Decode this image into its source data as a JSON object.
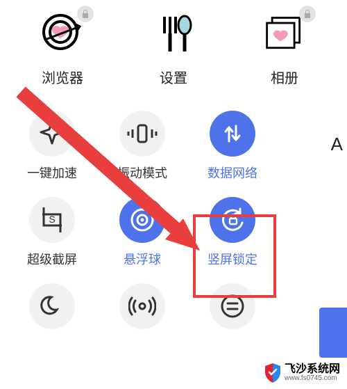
{
  "apps": [
    {
      "id": "browser",
      "label": "浏览器",
      "locked": true,
      "icon": "target-heart-icon"
    },
    {
      "id": "settings",
      "label": "设置",
      "locked": false,
      "icon": "cutlery-icon"
    },
    {
      "id": "gallery",
      "label": "相册",
      "locked": true,
      "icon": "photo-stack-icon"
    }
  ],
  "qs": {
    "row1": [
      {
        "id": "boost",
        "label": "一键加速",
        "on": false,
        "icon": "sparkle-icon"
      },
      {
        "id": "vibrate",
        "label": "振动模式",
        "on": false,
        "icon": "vibrate-icon"
      },
      {
        "id": "data",
        "label": "数据网络",
        "on": true,
        "icon": "data-arrows-icon"
      }
    ],
    "row2": [
      {
        "id": "sshot",
        "label": "超级截屏",
        "on": false,
        "icon": "crop-s-icon"
      },
      {
        "id": "float",
        "label": "悬浮球",
        "on": true,
        "icon": "target-ring-icon"
      },
      {
        "id": "plock",
        "label": "竖屏锁定",
        "on": true,
        "icon": "orientation-lock-icon",
        "highlighted": true
      }
    ],
    "row3": [
      {
        "id": "dnd",
        "label": "",
        "on": false,
        "icon": "moon-icon"
      },
      {
        "id": "hotspot",
        "label": "",
        "on": false,
        "icon": "hotspot-icon"
      },
      {
        "id": "text",
        "label": "",
        "on": false,
        "icon": "lines-icon"
      }
    ]
  },
  "side_label": "A",
  "colors": {
    "accent": "#4e72ea",
    "highlight": "#e93e3e"
  },
  "watermark": {
    "title": "飞沙系统网",
    "sub": "www.fs0745.com"
  }
}
